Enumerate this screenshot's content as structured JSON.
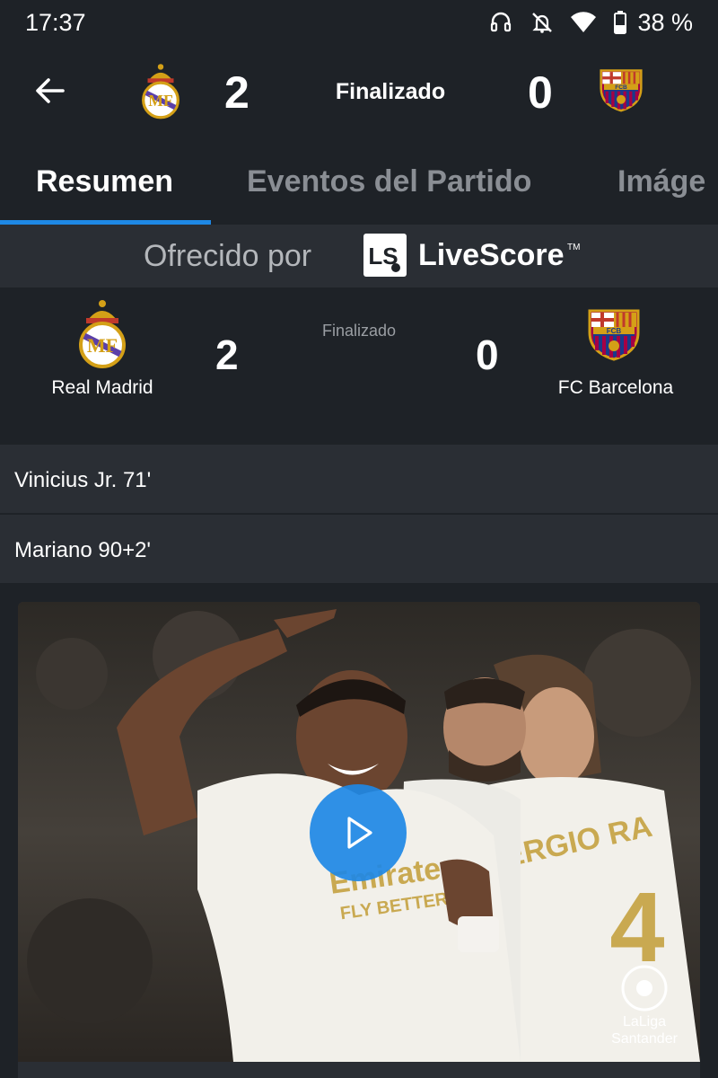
{
  "status_bar": {
    "time": "17:37",
    "battery": "38 %",
    "icons": [
      "headset-icon",
      "notifications-off-icon",
      "wifi-icon",
      "battery-icon"
    ]
  },
  "header": {
    "home_score": "2",
    "away_score": "0",
    "status": "Finalizado",
    "home_crest": "real-madrid-crest",
    "away_crest": "fc-barcelona-crest"
  },
  "tabs": [
    {
      "label": "Resumen",
      "active": true
    },
    {
      "label": "Eventos del Partido",
      "active": false
    },
    {
      "label": "Imáge",
      "active": false
    }
  ],
  "sponsor": {
    "text": "Ofrecido por",
    "logo_text": "LiveScore",
    "trademark": "TM",
    "logo_mark": "LS"
  },
  "score_card": {
    "home_name": "Real Madrid",
    "away_name": "FC Barcelona",
    "home_score": "2",
    "away_score": "0",
    "status": "Finalizado"
  },
  "scorers": [
    {
      "text": "Vinicius Jr. 71'"
    },
    {
      "text": "Mariano 90+2'"
    }
  ],
  "video": {
    "shirt_sponsor": "Emirates",
    "shirt_slogan": "FLY BETTER",
    "back_name": "SERGIO RA",
    "back_number": "4",
    "league_logo": "LaLiga Santander",
    "league_line1": "LaLiga",
    "league_line2": "Santander"
  },
  "colors": {
    "background": "#1e2227",
    "accent": "#1e88e5",
    "row": "#2a2e34"
  }
}
